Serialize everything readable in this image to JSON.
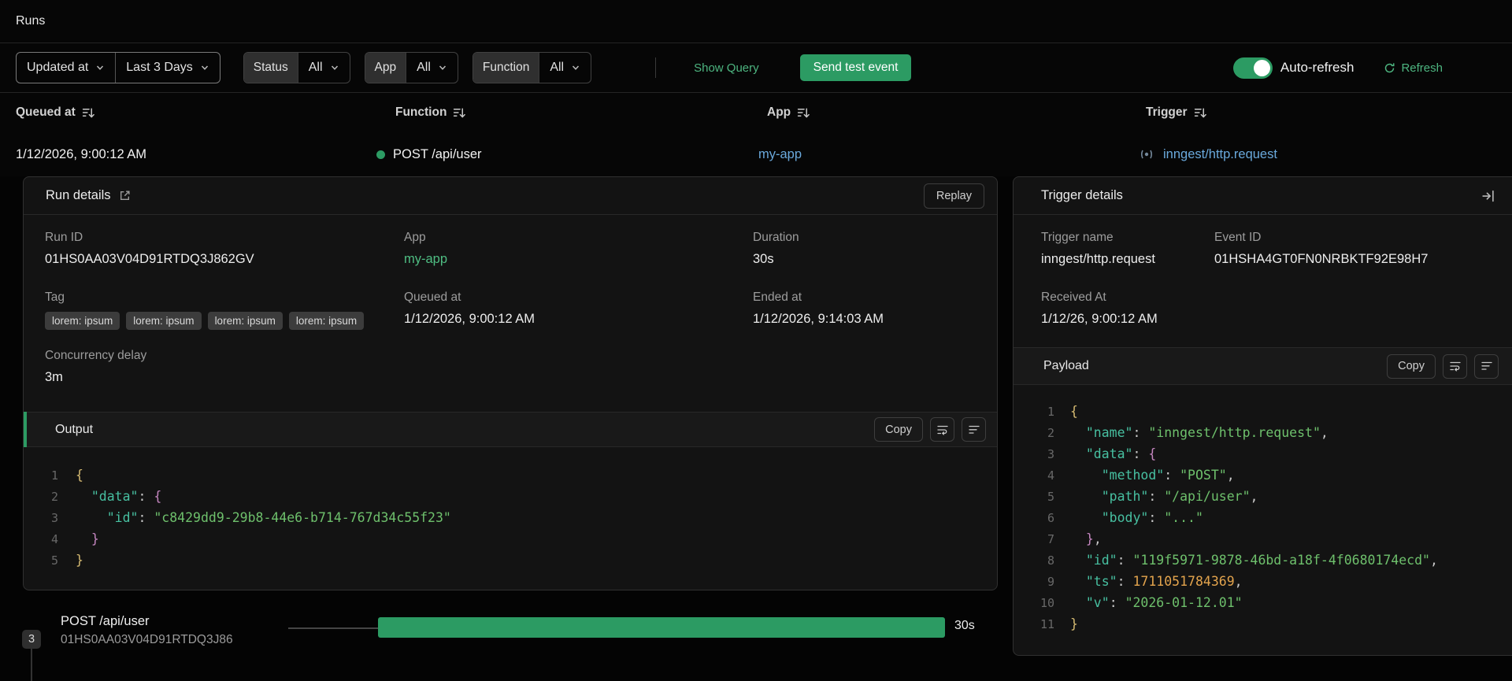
{
  "colors": {
    "accent_green": "#2c9b63",
    "green_text": "#4db580",
    "link_blue": "#6aa9dc",
    "status_dot": "#2c9b63"
  },
  "icons": {
    "dropdown": "chevron-down",
    "column_sort": "bars-arrow-down",
    "run_status": "green-dot",
    "trigger": "pulse",
    "run_details_link": "external-link",
    "collapse_panel": "arrow-right-to-bar",
    "refresh": "arrow-rotate",
    "code_actions": [
      "text-wrap",
      "align-left"
    ]
  },
  "topbar": {
    "title": "Runs"
  },
  "filters": {
    "sort_field": "Updated at",
    "time_range": "Last 3 Days",
    "status_label": "Status",
    "status_value": "All",
    "app_label": "App",
    "app_value": "All",
    "function_label": "Function",
    "function_value": "All",
    "show_query": "Show Query",
    "send_test_event": "Send test event",
    "auto_refresh": "Auto-refresh",
    "auto_refresh_on": true,
    "refresh": "Refresh"
  },
  "runs_table": {
    "headers": [
      "Queued at",
      "Function",
      "App",
      "Trigger"
    ],
    "row": {
      "queued_at": "1/12/2026, 9:00:12 AM",
      "function_name": "POST /api/user",
      "app": "my-app",
      "trigger": "inngest/http.request"
    }
  },
  "run_details": {
    "title": "Run details",
    "replay": "Replay",
    "run_id_label": "Run ID",
    "run_id": "01HS0AA03V04D91RTDQ3J862GV",
    "app_label": "App",
    "app": "my-app",
    "duration_label": "Duration",
    "duration": "30s",
    "tag_label": "Tag",
    "tags": [
      "lorem: ipsum",
      "lorem: ipsum",
      "lorem: ipsum",
      "lorem: ipsum"
    ],
    "queued_label": "Queued at",
    "queued": "1/12/2026, 9:00:12 AM",
    "ended_label": "Ended at",
    "ended": "1/12/2026, 9:14:03 AM",
    "concurrency_label": "Concurrency delay",
    "concurrency": "3m"
  },
  "output": {
    "title": "Output",
    "copy": "Copy",
    "code": [
      [
        [
          "b1",
          "{"
        ]
      ],
      [
        [
          "ws",
          "  "
        ],
        [
          "key",
          "\"data\""
        ],
        [
          "p",
          ": "
        ],
        [
          "b2",
          "{"
        ]
      ],
      [
        [
          "ws",
          "    "
        ],
        [
          "key",
          "\"id\""
        ],
        [
          "p",
          ": "
        ],
        [
          "str",
          "\"c8429dd9-29b8-44e6-b714-767d34c55f23\""
        ]
      ],
      [
        [
          "ws",
          "  "
        ],
        [
          "b2",
          "}"
        ]
      ],
      [
        [
          "b1",
          "}"
        ]
      ]
    ]
  },
  "trigger_details": {
    "title": "Trigger details",
    "trigger_name_label": "Trigger name",
    "trigger_name": "inngest/http.request",
    "event_id_label": "Event ID",
    "event_id": "01HSHA4GT0FN0NRBKTF92E98H7",
    "received_label": "Received At",
    "received": "1/12/26, 9:00:12 AM",
    "payload": {
      "title": "Payload",
      "copy": "Copy",
      "code": [
        [
          [
            "b1",
            "{"
          ]
        ],
        [
          [
            "ws",
            "  "
          ],
          [
            "key",
            "\"name\""
          ],
          [
            "p",
            ": "
          ],
          [
            "str",
            "\"inngest/http.request\""
          ],
          [
            "p",
            ","
          ]
        ],
        [
          [
            "ws",
            "  "
          ],
          [
            "key",
            "\"data\""
          ],
          [
            "p",
            ": "
          ],
          [
            "b2",
            "{"
          ]
        ],
        [
          [
            "ws",
            "    "
          ],
          [
            "key",
            "\"method\""
          ],
          [
            "p",
            ": "
          ],
          [
            "str",
            "\"POST\""
          ],
          [
            "p",
            ","
          ]
        ],
        [
          [
            "ws",
            "    "
          ],
          [
            "key",
            "\"path\""
          ],
          [
            "p",
            ": "
          ],
          [
            "str",
            "\"/api/user\""
          ],
          [
            "p",
            ","
          ]
        ],
        [
          [
            "ws",
            "    "
          ],
          [
            "key",
            "\"body\""
          ],
          [
            "p",
            ": "
          ],
          [
            "str",
            "\"...\""
          ]
        ],
        [
          [
            "ws",
            "  "
          ],
          [
            "b2",
            "}"
          ],
          [
            "p",
            ","
          ]
        ],
        [
          [
            "ws",
            "  "
          ],
          [
            "key",
            "\"id\""
          ],
          [
            "p",
            ": "
          ],
          [
            "str",
            "\"119f5971-9878-46bd-a18f-4f0680174ecd\""
          ],
          [
            "p",
            ","
          ]
        ],
        [
          [
            "ws",
            "  "
          ],
          [
            "key",
            "\"ts\""
          ],
          [
            "p",
            ": "
          ],
          [
            "num",
            "1711051784369"
          ],
          [
            "p",
            ","
          ]
        ],
        [
          [
            "ws",
            "  "
          ],
          [
            "key",
            "\"v\""
          ],
          [
            "p",
            ": "
          ],
          [
            "str",
            "\"2026-01-12.01\""
          ]
        ],
        [
          [
            "b1",
            "}"
          ]
        ]
      ]
    }
  },
  "timeline": {
    "step_number": "3",
    "name": "POST /api/user",
    "run_id": "01HS0AA03V04D91RTDQ3J86",
    "duration": "30s"
  }
}
